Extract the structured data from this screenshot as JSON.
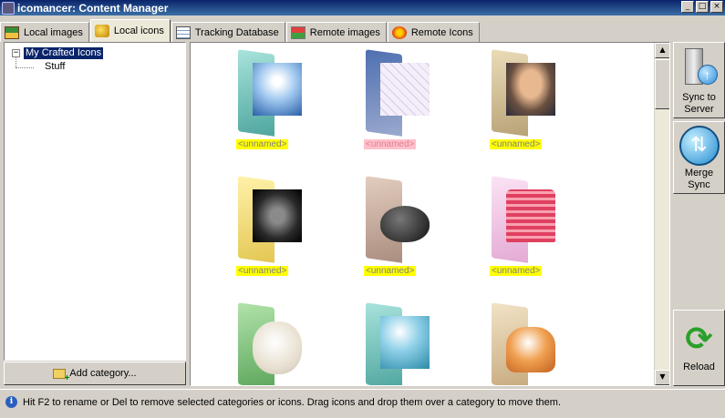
{
  "window": {
    "title": "icomancer: Content Manager",
    "buttons": [
      "_",
      "□",
      "×"
    ]
  },
  "tabs": [
    {
      "label": "Local images",
      "icon": "images-icon",
      "active": false
    },
    {
      "label": "Local icons",
      "icon": "local-icons-icon",
      "active": true
    },
    {
      "label": "Tracking Database",
      "icon": "database-icon",
      "active": false
    },
    {
      "label": "Remote images",
      "icon": "remote-images-icon",
      "active": false
    },
    {
      "label": "Remote Icons",
      "icon": "remote-icons-icon",
      "active": false
    }
  ],
  "tree": {
    "expander": "−",
    "root": "My Crafted Icons",
    "children": [
      "Stuff"
    ]
  },
  "add_category_label": "Add category...",
  "icons": [
    {
      "label": "<unnamed>",
      "folder": "teal-folder",
      "image": "sky-clouds",
      "highlight": "yellow"
    },
    {
      "label": "<unnamed>",
      "folder": "white-folder",
      "image": "map",
      "highlight": "pink"
    },
    {
      "label": "<unnamed>",
      "folder": "beige-folder",
      "image": "old-man-portrait",
      "highlight": "yellow"
    },
    {
      "label": "<unnamed>",
      "folder": "yellow-folder",
      "image": "dark-portrait",
      "highlight": "yellow"
    },
    {
      "label": "<unnamed>",
      "folder": "brown-folder",
      "image": "cauldron",
      "highlight": "yellow"
    },
    {
      "label": "<unnamed>",
      "folder": "pink-folder",
      "image": "easter-basket",
      "highlight": "yellow"
    },
    {
      "label": "<unnamed>",
      "folder": "green-folder",
      "image": "lamb",
      "highlight": "yellow"
    },
    {
      "label": "<unnamed>",
      "folder": "teal-folder",
      "image": "sky",
      "highlight": "yellow"
    },
    {
      "label": "<unnamed>",
      "folder": "beige-folder",
      "image": "kitten",
      "highlight": "yellow"
    }
  ],
  "scrollbar": {
    "up": "▲",
    "down": "▼"
  },
  "side_buttons": {
    "sync": {
      "line1": "Sync to",
      "line2": "Server",
      "icon": "server-sync-icon"
    },
    "merge": {
      "line1": "Merge",
      "line2": "Sync",
      "icon": "merge-sync-icon"
    },
    "reload": {
      "label": "Reload",
      "icon": "reload-icon"
    }
  },
  "status_text": "Hit F2 to rename or Del to remove selected categories or icons. Drag icons and drop them over a category to move them.",
  "colors": {
    "selection": "#0a246a",
    "label_highlight": "#ffff00",
    "label_highlight_selected": "#ffc0cb"
  }
}
